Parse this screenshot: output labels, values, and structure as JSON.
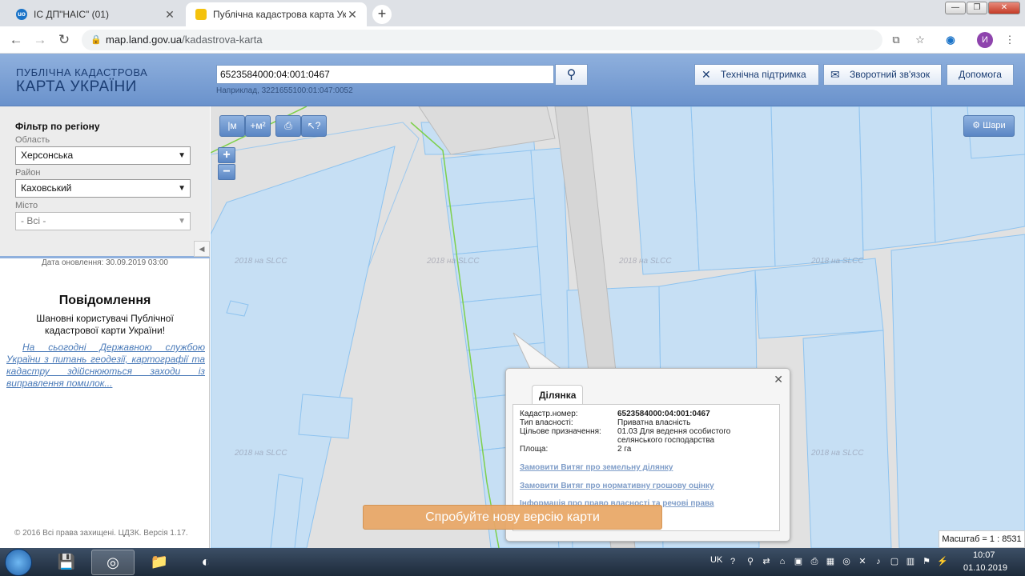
{
  "browser": {
    "tabs": [
      {
        "title": "ІС ДП\"НАІС\" (01)",
        "favicon": "uo-logo-icon"
      },
      {
        "title": "Публічна кадастрова карта України",
        "favicon": "trident-icon"
      }
    ],
    "url_host": "map.land.gov.ua",
    "url_path": "/kadastrova-karta",
    "profile_initial": "И"
  },
  "header": {
    "logo_line1": "ПУБЛІЧНА КАДАСТРОВА",
    "logo_line2": "КАРТА УКРАЇНИ",
    "search_value": "6523584000:04:001:0467",
    "search_hint": "Наприклад, 3221655100:01:047:0052",
    "buttons": {
      "support": "Технічна підтримка",
      "feedback": "Зворотний зв'язок",
      "help": "Допомога"
    }
  },
  "sidebar": {
    "filter_title": "Фільтр по регіону",
    "oblast_label": "Область",
    "oblast_value": "Херсонська",
    "rayon_label": "Район",
    "rayon_value": "Каховський",
    "city_label": "Місто",
    "city_value": "- Всі -",
    "updated": "Дата оновлення: 30.09.2019 03:00",
    "notice_title": "Повідомлення",
    "notice_body": "Шановні користувачі Публічної кадастрової карти України!",
    "notice_link": "На сьогодні Державною службою України з питань геодезії, картографії та кадастру здійснюються заходи із виправлення помилок...",
    "copyright": "© 2016 Всі права захищені. ЦДЗК. Версія 1.17."
  },
  "map": {
    "tools": {
      "measure_line": "|м",
      "measure_area": "+м²",
      "print": "print-icon",
      "identify": "?"
    },
    "zoom_in": "+",
    "zoom_out": "−",
    "layers_button": "Шари",
    "watermark": "2018 на SLCC",
    "scale": "Масштаб = 1 : 8531",
    "try_new": "Спробуйте нову версію карти"
  },
  "popup": {
    "tab": "Ділянка",
    "fields": [
      {
        "key": "Кадастр.номер:",
        "value": "6523584000:04:001:0467"
      },
      {
        "key": "Тип власності:",
        "value": "Приватна власність"
      },
      {
        "key": "Цільове призначення:",
        "value": "01.03 Для ведення особистого селянського господарства"
      },
      {
        "key": "Площа:",
        "value": "2 га"
      }
    ],
    "links": [
      "Замовити Витяг про земельну ділянку",
      "Замовити Витяг про нормативну грошову оцінку",
      "Інформація про право власності та речові права"
    ]
  },
  "taskbar": {
    "lang": "UK",
    "time": "10:07",
    "date": "01.10.2019"
  }
}
